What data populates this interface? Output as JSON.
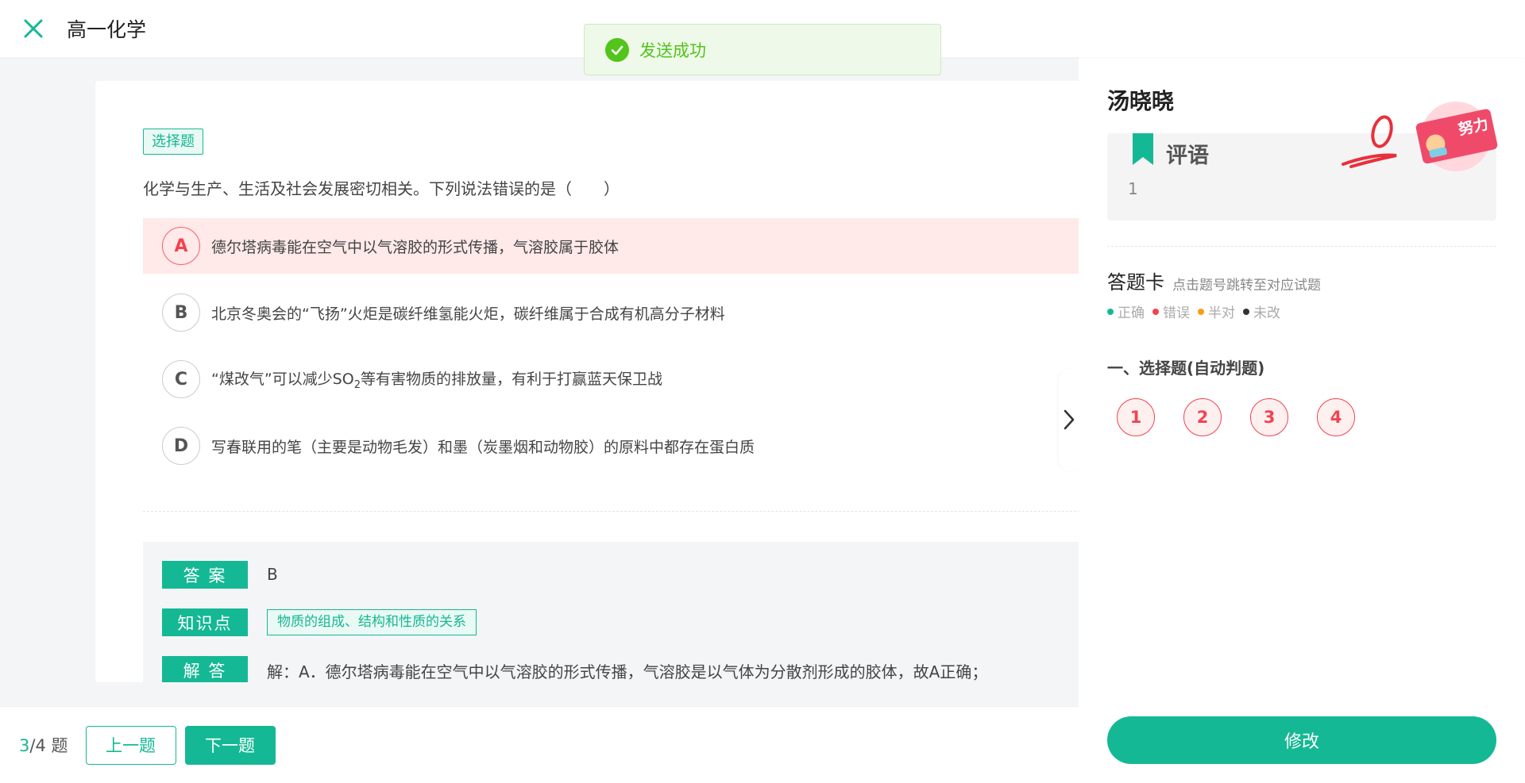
{
  "topbar": {
    "title": "高一化学"
  },
  "toast": {
    "message": "发送成功"
  },
  "question": {
    "type_label": "选择题",
    "stem": "化学与生产、生活及社会发展密切相关。下列说法错误的是（　　）",
    "options": [
      {
        "letter": "A",
        "text": "德尔塔病毒能在空气中以气溶胶的形式传播，气溶胶属于胶体",
        "state": "wrong"
      },
      {
        "letter": "B",
        "text": "北京冬奥会的“飞扬”火炬是碳纤维氢能火炬，碳纤维属于合成有机高分子材料",
        "state": "normal"
      },
      {
        "letter": "C",
        "text_before": "“煤改气”可以减少SO",
        "text_sub": "2",
        "text_after": "等有害物质的排放量，有利于打赢蓝天保卫战",
        "state": "normal"
      },
      {
        "letter": "D",
        "text": "写春联用的笔（主要是动物毛发）和墨（炭墨烟和动物胶）的原料中都存在蛋白质",
        "state": "normal"
      }
    ]
  },
  "answer_area": {
    "answer_label": "答 案",
    "answer_value": "B",
    "knowledge_label": "知识点",
    "knowledge_value": "物质的组成、结构和性质的关系",
    "analysis_label": "解 答",
    "analysis_value": "解：A．德尔塔病毒能在空气中以气溶胶的形式传播，气溶胶是以气体为分散剂形成的胶体，故A正确；"
  },
  "pager": {
    "current": "3",
    "total_text": "/4 题",
    "prev_label": "上一题",
    "next_label": "下一题"
  },
  "panel": {
    "student_name": "汤晓晓",
    "comment_title": "评语",
    "comment_text": "1",
    "stamp_text": "努力",
    "card_title": "答题卡",
    "card_hint": "点击题号跳转至对应试题",
    "legend": [
      {
        "label": "正确",
        "color": "#15b894"
      },
      {
        "label": "错误",
        "color": "#f2434f"
      },
      {
        "label": "半对",
        "color": "#fa9b1a"
      },
      {
        "label": "未改",
        "color": "#333333"
      }
    ],
    "section_title": "一、选择题(自动判题)",
    "question_numbers": [
      "1",
      "2",
      "3",
      "4"
    ],
    "edit_label": "修改"
  },
  "colors": {
    "accent": "#15b894",
    "wrong": "#f2434f",
    "success": "#52c41a"
  }
}
